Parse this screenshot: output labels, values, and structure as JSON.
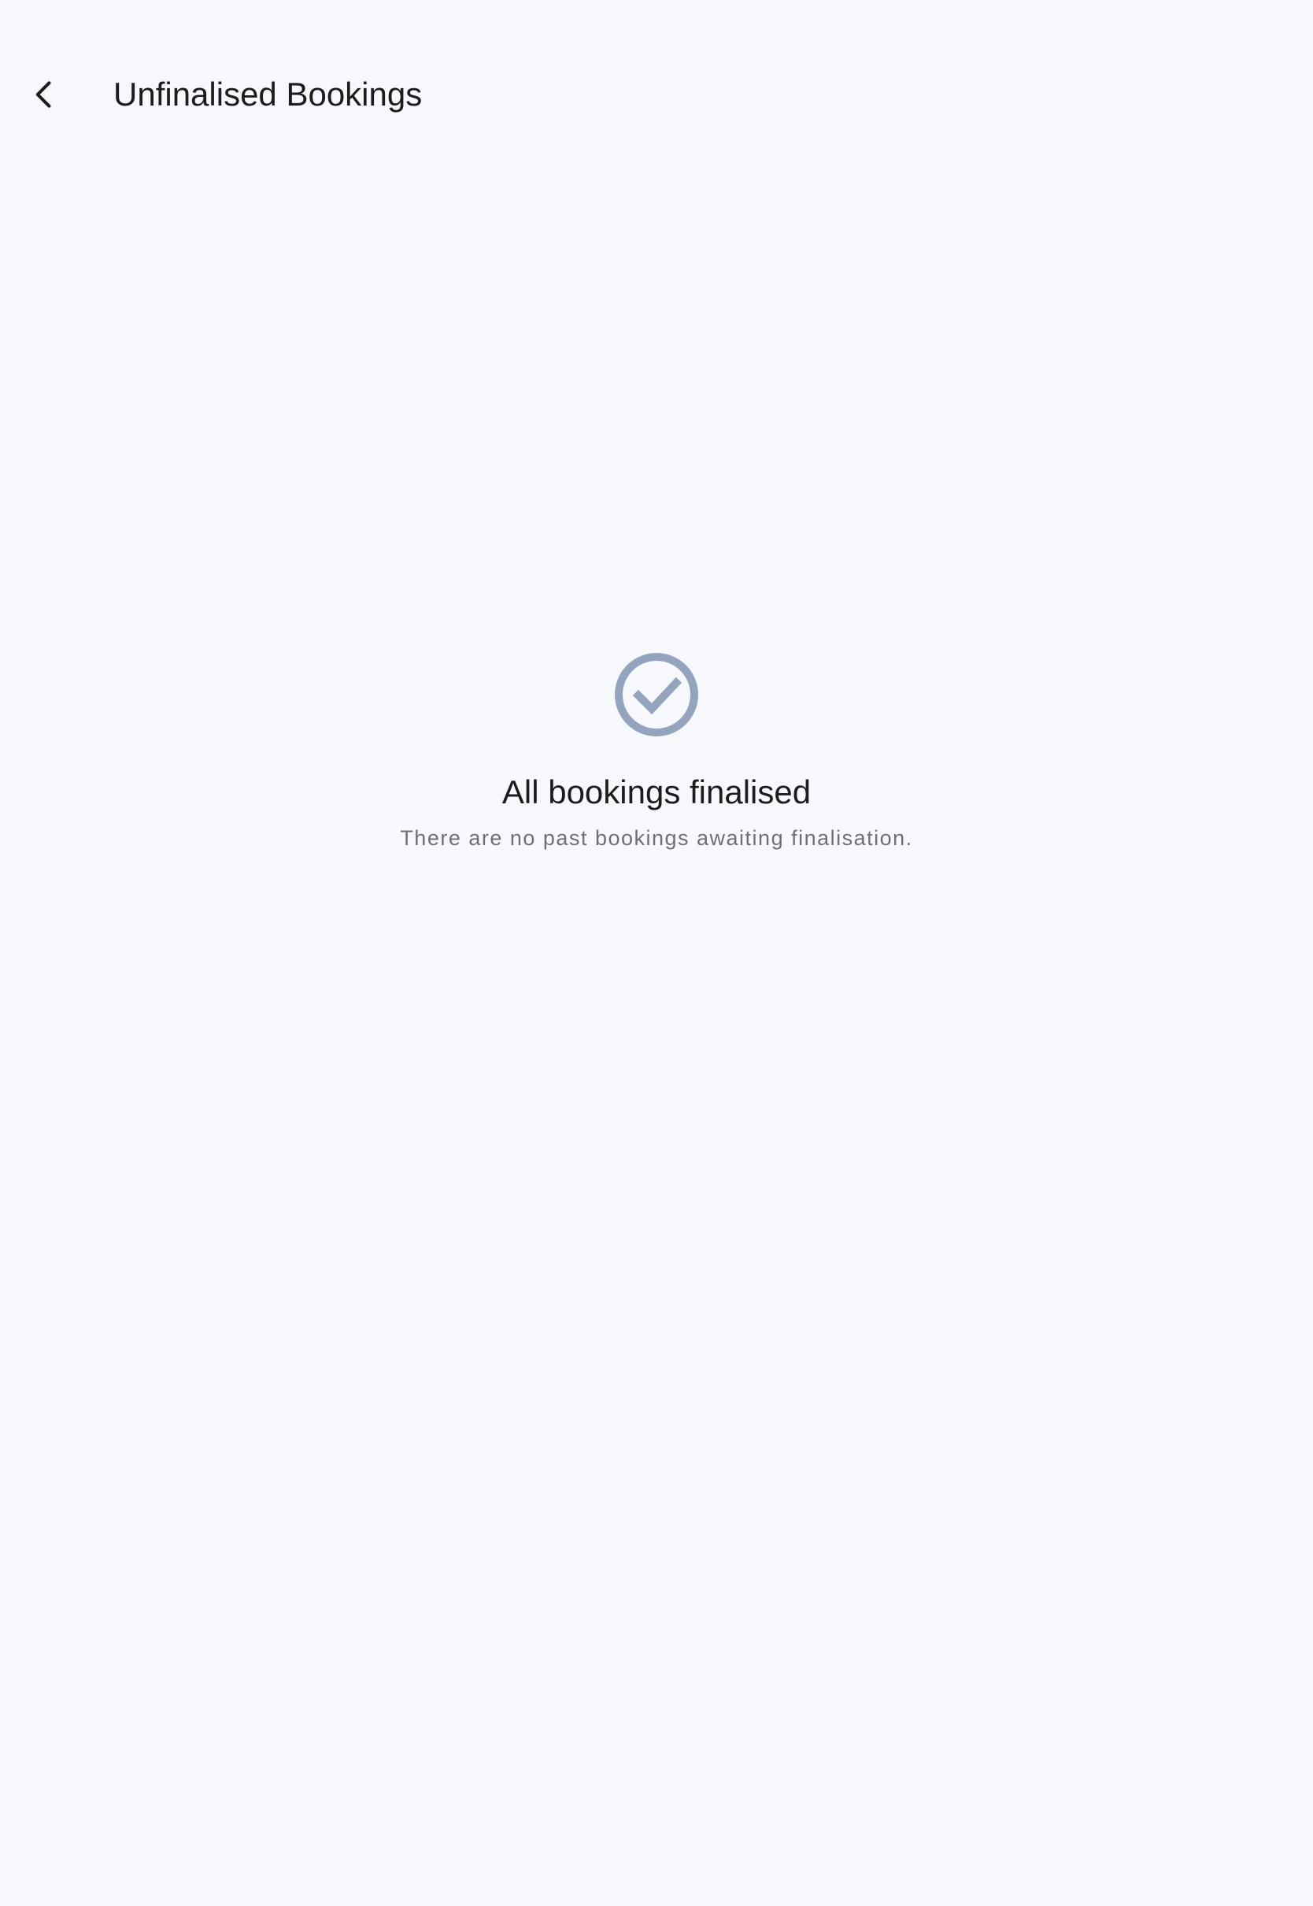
{
  "header": {
    "title": "Unfinalised Bookings",
    "back_icon": "chevron-left-icon"
  },
  "empty_state": {
    "icon": "check-circle-icon",
    "icon_color": "#93a4bf",
    "title": "All bookings finalised",
    "message": "There are no past bookings awaiting finalisation."
  },
  "colors": {
    "background": "#f7f8fc",
    "text_primary": "#1c1c1f",
    "text_secondary": "#6f6f74"
  }
}
